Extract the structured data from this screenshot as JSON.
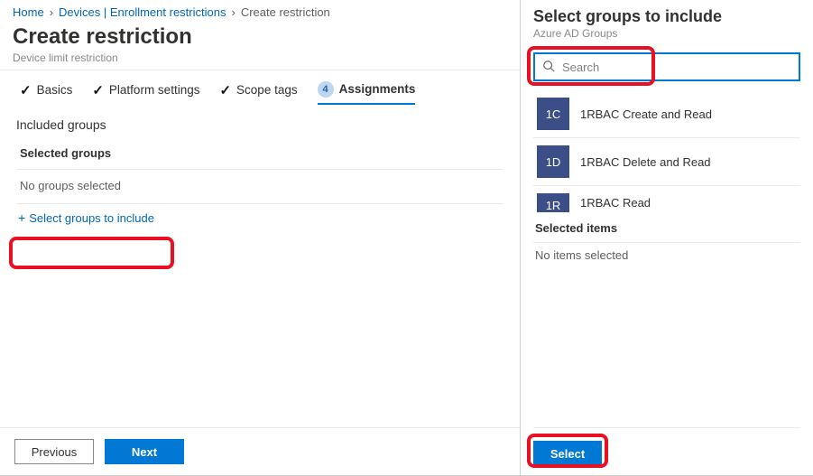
{
  "breadcrumb": {
    "home": "Home",
    "devices": "Devices | Enrollment restrictions",
    "current": "Create restriction"
  },
  "header": {
    "title": "Create restriction",
    "subtitle": "Device limit restriction"
  },
  "steps": {
    "basics": "Basics",
    "platform": "Platform settings",
    "scope": "Scope tags",
    "assignments_num": "4",
    "assignments": "Assignments"
  },
  "included": {
    "heading": "Included groups",
    "selected_heading": "Selected groups",
    "empty": "No groups selected",
    "select_link": "Select groups to include"
  },
  "footer": {
    "previous": "Previous",
    "next": "Next"
  },
  "panel": {
    "title": "Select groups to include",
    "subtitle": "Azure AD Groups",
    "search_placeholder": "Search",
    "groups": [
      {
        "initials": "1C",
        "name": "1RBAC Create and Read"
      },
      {
        "initials": "1D",
        "name": "1RBAC Delete and Read"
      },
      {
        "initials": "1R",
        "name": "1RBAC Read"
      }
    ],
    "selected_heading": "Selected items",
    "no_items": "No items selected",
    "select_btn": "Select"
  }
}
